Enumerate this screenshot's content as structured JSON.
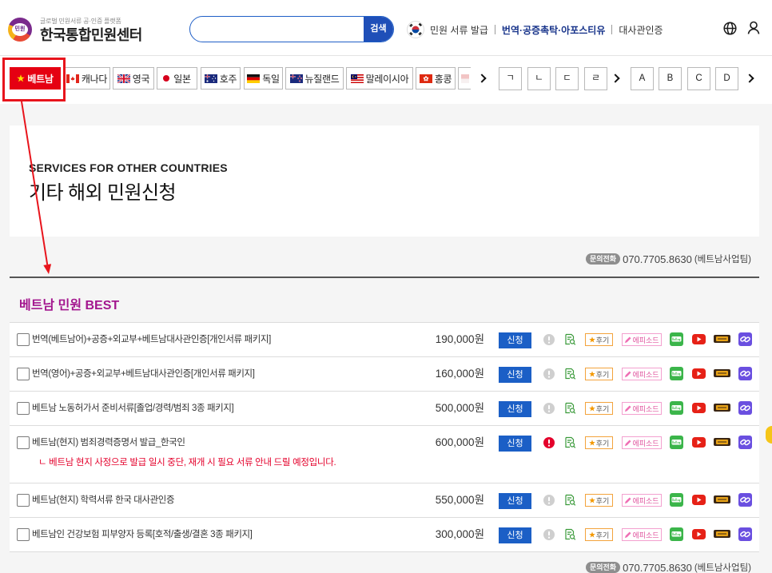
{
  "header": {
    "logo_badge": "민원",
    "logo_tagline": "글로벌 민원서류 공·인증 플랫폼",
    "logo_title": "한국통합민원센터",
    "search_value": "",
    "search_button": "검색",
    "nav": [
      "민원 서류 발급",
      "번역·공증촉탁·아포스티유",
      "대사관인증"
    ],
    "icons": {
      "flag": "korea-flag-icon",
      "language": "globe-icon",
      "account": "user-icon"
    }
  },
  "country_tabs": [
    {
      "label": "베트남",
      "flag": "vietnam-flag-icon",
      "active": true
    },
    {
      "label": "캐나다",
      "flag": "canada-flag-icon"
    },
    {
      "label": "영국",
      "flag": "uk-flag-icon"
    },
    {
      "label": "일본",
      "flag": "japan-flag-icon"
    },
    {
      "label": "호주",
      "flag": "australia-flag-icon"
    },
    {
      "label": "독일",
      "flag": "germany-flag-icon"
    },
    {
      "label": "뉴질랜드",
      "flag": "new-zealand-flag-icon"
    },
    {
      "label": "말레이시아",
      "flag": "malaysia-flag-icon"
    },
    {
      "label": "홍콩",
      "flag": "hong-kong-flag-icon"
    }
  ],
  "index_consonants": [
    "ㄱ",
    "ㄴ",
    "ㄷ",
    "ㄹ"
  ],
  "index_letters": [
    "A",
    "B",
    "C",
    "D"
  ],
  "hero": {
    "subtitle": "SERVICES FOR OTHER COUNTRIES",
    "title": "기타 해외 민원신청"
  },
  "contact": {
    "badge": "문의전화",
    "phone": "070.7705.8630",
    "team": "(베트남사업팀)"
  },
  "best": {
    "title": "베트남 민원 BEST",
    "apply_label": "신청",
    "review_label": "후기",
    "episode_label": "에피소드",
    "row_icons": [
      "info-icon",
      "document-search-icon",
      "blog-icon",
      "youtube-icon",
      "book-icon",
      "link-icon"
    ],
    "rows": [
      {
        "title": "번역(베트남어)+공증+외교부+베트남대사관인증[개인서류 패키지]",
        "price": "190,000원",
        "alert": false
      },
      {
        "title": "번역(영어)+공증+외교부+베트남대사관인증[개인서류 패키지]",
        "price": "160,000원",
        "alert": false
      },
      {
        "title": "베트남 노동허가서 준비서류[졸업/경력/범죄 3종 패키지]",
        "price": "500,000원",
        "alert": false
      },
      {
        "title": "베트남(현지) 범죄경력증명서 발급_한국인",
        "price": "600,000원",
        "alert": true,
        "note": "ㄴ 베트남 현지 사정으로 발급 일시 중단, 재개 시 필요 서류 안내 드릴 예정입니다."
      },
      {
        "title": "베트남(현지) 학력서류 한국 대사관인증",
        "price": "550,000원",
        "alert": false
      },
      {
        "title": "베트남인 건강보험 피부양자 등록[호적/출생/결혼 3종 패키지]",
        "price": "300,000원",
        "alert": false
      }
    ]
  },
  "colors": {
    "accent": "#1b5fc6",
    "active_tab": "#e50012",
    "best_title": "#a3168e",
    "notice": "#e4002b",
    "annotation": "#e8141c"
  }
}
